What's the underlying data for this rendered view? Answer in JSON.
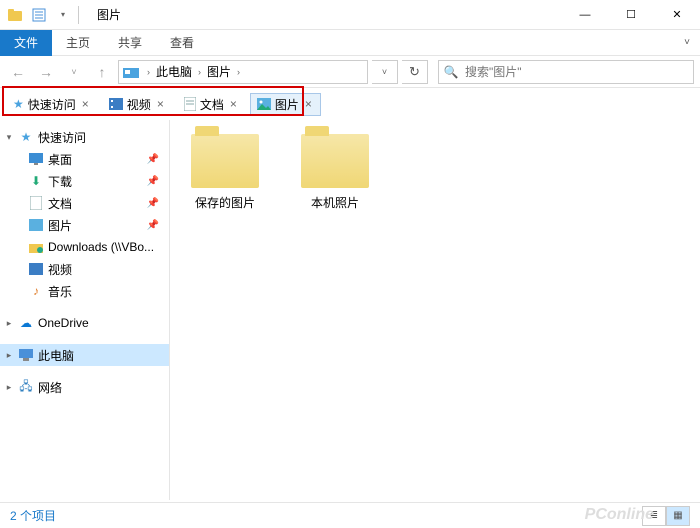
{
  "window": {
    "title": "图片",
    "controls": {
      "minimize": "—",
      "maximize": "☐",
      "close": "✕"
    }
  },
  "ribbon": {
    "file": "文件",
    "tabs": [
      "主页",
      "共享",
      "查看"
    ]
  },
  "address": {
    "back": "←",
    "forward": "→",
    "history_drop": "˅",
    "up": "↑",
    "segments": [
      "此电脑",
      "图片"
    ],
    "refresh": "↻"
  },
  "search": {
    "placeholder": "搜索\"图片\""
  },
  "file_tabs": [
    {
      "label": "快速访问",
      "icon": "star"
    },
    {
      "label": "视频",
      "icon": "video"
    },
    {
      "label": "文档",
      "icon": "doc"
    },
    {
      "label": "图片",
      "icon": "pic",
      "active": true
    }
  ],
  "sidebar": {
    "quick": {
      "label": "快速访问",
      "children": [
        {
          "label": "桌面",
          "icon": "desktop",
          "pinned": true
        },
        {
          "label": "下载",
          "icon": "download",
          "pinned": true
        },
        {
          "label": "文档",
          "icon": "doc",
          "pinned": true
        },
        {
          "label": "图片",
          "icon": "pic",
          "pinned": true
        },
        {
          "label": "Downloads (\\\\VBo...",
          "icon": "netfolder"
        },
        {
          "label": "视频",
          "icon": "video"
        },
        {
          "label": "音乐",
          "icon": "music"
        }
      ]
    },
    "onedrive": "OneDrive",
    "thispc": "此电脑",
    "network": "网络"
  },
  "content": {
    "items": [
      {
        "name": "保存的图片"
      },
      {
        "name": "本机照片"
      }
    ]
  },
  "statusbar": {
    "count": "2 个项目"
  },
  "watermark": "PConline"
}
